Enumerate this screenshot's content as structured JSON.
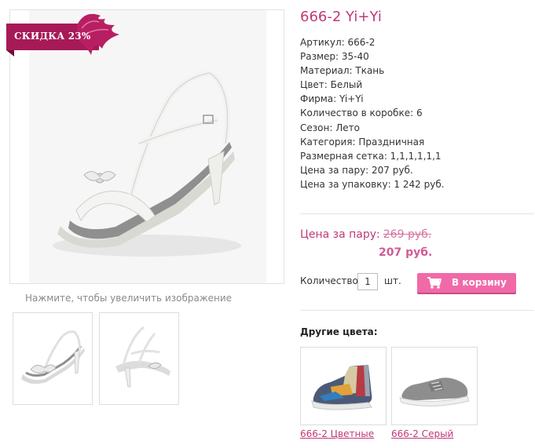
{
  "product": {
    "title": "666-2 Yi+Yi",
    "discount_badge": "СКИДКА 23%",
    "zoom_hint": "Нажмите, чтобы увеличить изображение"
  },
  "specs": [
    "Артикул: 666-2",
    "Размер: 35-40",
    "Материал: Ткань",
    "Цвет: Белый",
    "Фирма: Yi+Yi",
    "Количество в коробке: 6",
    "Сезон: Лето",
    "Категория: Праздничная",
    "Размерная сетка: 1,1,1,1,1,1",
    "Цена за пару: 207 руб.",
    "Цена за упаковку: 1 242 руб."
  ],
  "price": {
    "label": "Цена за пару:",
    "old": "269 руб.",
    "new": "207 руб."
  },
  "order": {
    "qty_label": "Количество",
    "qty_value": "1",
    "qty_unit": "шт.",
    "cart_button": "В корзину"
  },
  "other_colors": {
    "title": "Другие цвета:",
    "items": [
      {
        "label": "666-2 Цветные"
      },
      {
        "label": "666-2 Серый"
      }
    ]
  },
  "colors": {
    "accent": "#c0397a",
    "badge": "#a61a57",
    "button": "#f06aa8"
  }
}
